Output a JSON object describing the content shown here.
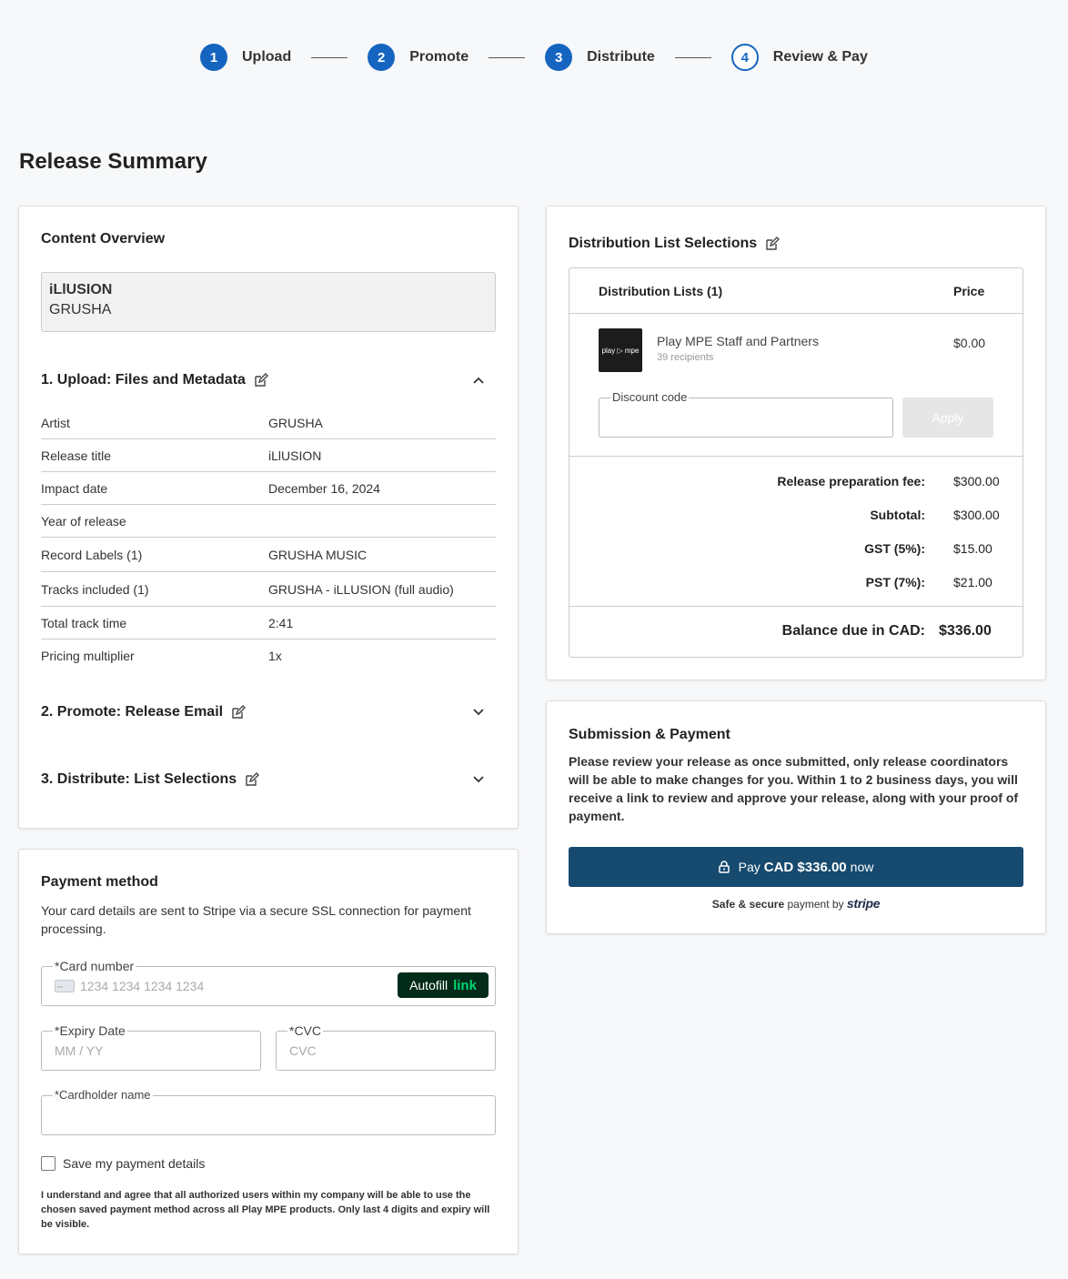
{
  "stepper": {
    "steps": [
      {
        "num": "1",
        "label": "Upload"
      },
      {
        "num": "2",
        "label": "Promote"
      },
      {
        "num": "3",
        "label": "Distribute"
      },
      {
        "num": "4",
        "label": "Review & Pay"
      }
    ]
  },
  "page_title": "Release Summary",
  "content_overview": {
    "title": "Content Overview",
    "release_title": "iLlUSION",
    "artist": "GRUSHA",
    "section1": "1. Upload: Files and Metadata",
    "section2": "2. Promote: Release Email",
    "section3": "3. Distribute: List Selections",
    "metadata": [
      {
        "k": "Artist",
        "v": "GRUSHA"
      },
      {
        "k": "Release title",
        "v": "iLlUSION"
      },
      {
        "k": "Impact date",
        "v": "December 16, 2024"
      },
      {
        "k": "Year of release",
        "v": ""
      },
      {
        "k": "Record Labels (1)",
        "v": "GRUSHA MUSIC"
      },
      {
        "k": "Tracks included (1)",
        "v": "GRUSHA - iLLUSION (full audio)"
      },
      {
        "k": "Total track time",
        "v": "2:41"
      },
      {
        "k": "Pricing multiplier",
        "v": "1x"
      }
    ]
  },
  "payment_method": {
    "title": "Payment method",
    "description": "Your card details are sent to Stripe via a secure SSL connection for payment processing.",
    "card_number_label": "*Card number",
    "card_number_placeholder": "1234 1234 1234 1234",
    "autofill_label": "Autofill",
    "autofill_link": "link",
    "expiry_label": "*Expiry Date",
    "expiry_placeholder": "MM / YY",
    "cvc_label": "*CVC",
    "cvc_placeholder": "CVC",
    "cardholder_label": "*Cardholder name",
    "save_label": "Save my payment details",
    "consent": "I understand and agree that all authorized users within my company will be able to use the chosen saved payment method across all Play MPE products. Only last 4 digits and expiry will be visible."
  },
  "distribution": {
    "title": "Distribution List Selections",
    "col_lists": "Distribution Lists (1)",
    "col_price": "Price",
    "item": {
      "logo_text": "play ▷ mpe",
      "name": "Play MPE Staff and Partners",
      "recipients": "39 recipients",
      "price": "$0.00"
    },
    "discount_label": "Discount code",
    "apply_label": "Apply",
    "fees": [
      {
        "k": "Release preparation fee:",
        "v": "$300.00"
      },
      {
        "k": "Subtotal:",
        "v": "$300.00"
      },
      {
        "k": "GST (5%):",
        "v": "$15.00"
      },
      {
        "k": "PST (7%):",
        "v": "$21.00"
      }
    ],
    "balance_label": "Balance due in CAD:",
    "balance_value": "$336.00"
  },
  "submission": {
    "title": "Submission & Payment",
    "description": "Please review your release as once submitted, only release coordinators will be able to make changes for you. Within 1 to 2 business days, you will receive a link to review and approve your release, along with your proof of payment.",
    "pay_prefix": "Pay",
    "pay_amount": "CAD $336.00",
    "pay_suffix": "now",
    "secure_text": "Safe & secure",
    "secure_by": "payment by",
    "stripe": "stripe"
  },
  "colors": {
    "accent": "#1565c0",
    "pay_button": "#164a6e",
    "link_green": "#00d66f"
  }
}
